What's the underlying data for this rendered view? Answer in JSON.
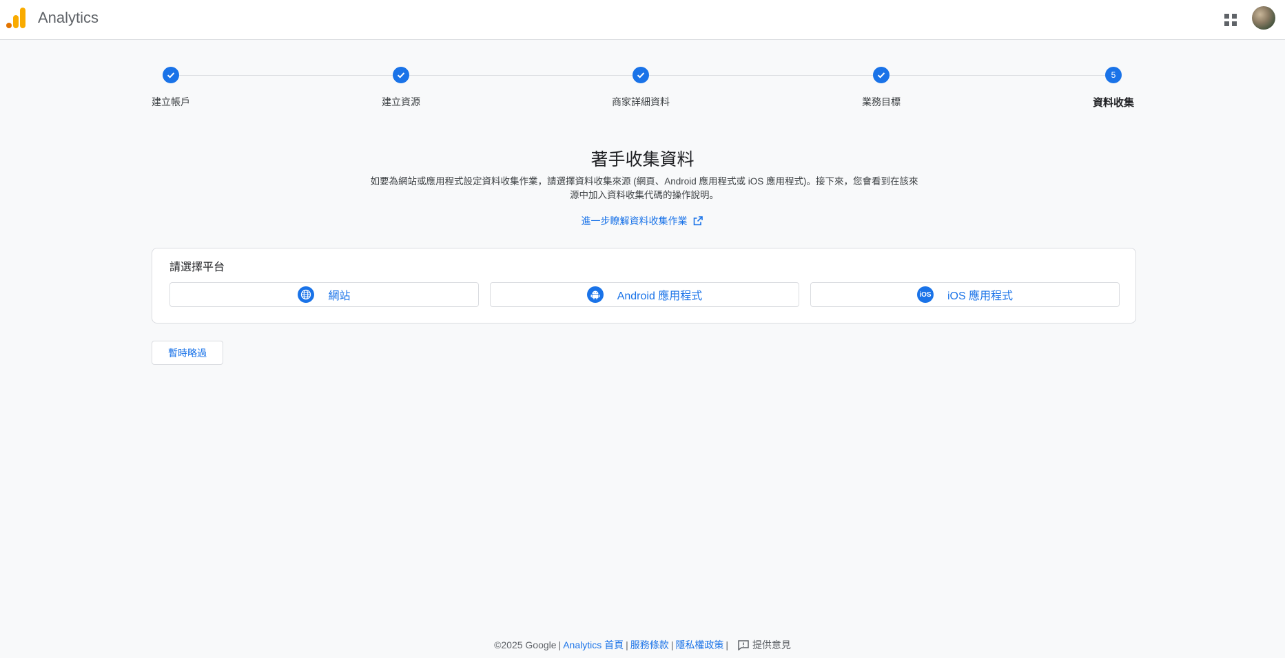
{
  "header": {
    "app_title": "Analytics",
    "logo_icon": "analytics-logo",
    "apps_icon": "apps-grid-icon",
    "avatar_icon": "account-avatar"
  },
  "stepper": {
    "steps": [
      {
        "label": "建立帳戶",
        "state": "done"
      },
      {
        "label": "建立資源",
        "state": "done"
      },
      {
        "label": "商家詳細資料",
        "state": "done"
      },
      {
        "label": "業務目標",
        "state": "done"
      },
      {
        "label": "資料收集",
        "state": "active",
        "number": "5"
      }
    ]
  },
  "main": {
    "title": "著手收集資料",
    "description": "如要為網站或應用程式設定資料收集作業，請選擇資料收集來源 (網頁、Android 應用程式或 iOS 應用程式)。接下來，您會看到在該來源中加入資料收集代碼的操作說明。",
    "learn_more_link": "進一步瞭解資料收集作業"
  },
  "platform": {
    "title": "請選擇平台",
    "buttons": [
      {
        "label": "網站",
        "icon": "globe-icon"
      },
      {
        "label": "Android 應用程式",
        "icon": "android-icon"
      },
      {
        "label": "iOS 應用程式",
        "icon": "ios-icon",
        "icon_text": "iOS"
      }
    ]
  },
  "skip_button": "暫時略過",
  "footer": {
    "copyright": "©2025 Google",
    "links": [
      "Analytics 首頁",
      "服務條款",
      "隱私權政策"
    ],
    "feedback": "提供意見"
  },
  "colors": {
    "accent": "#1a73e8",
    "background": "#f8f9fa",
    "logo_orange": "#f9ab00",
    "logo_dark_orange": "#e37400"
  }
}
